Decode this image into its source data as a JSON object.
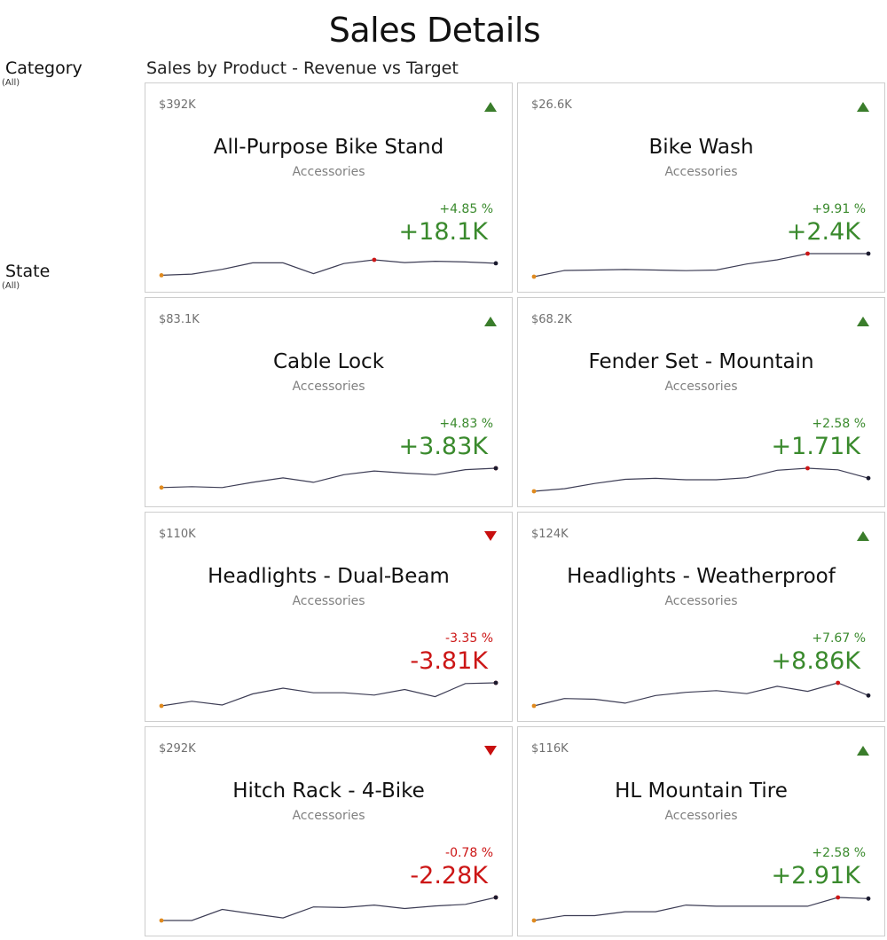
{
  "title": "Sales Details",
  "filters": [
    {
      "label": "Category",
      "value": "(All)"
    },
    {
      "label": "State",
      "value": "(All)"
    }
  ],
  "cards_title": "Sales by Product - Revenue vs Target",
  "colors": {
    "positive": "#3a8a2d",
    "negative": "#cc1616",
    "spark_line": "#3d3d55",
    "spark_start": "#e08a1e",
    "spark_max": "#cc1616",
    "spark_end": "#1a1a2e"
  },
  "cards": [
    {
      "name": "All-Purpose Bike Stand",
      "category": "Accessories",
      "actual": "$392K",
      "percent": "+4.85 %",
      "delta": "+18.1K",
      "trend": "up",
      "sparkline": [
        0.06,
        0.11,
        0.32,
        0.6,
        0.6,
        0.13,
        0.57,
        0.73,
        0.61,
        0.67,
        0.64,
        0.58
      ]
    },
    {
      "name": "Bike Wash",
      "category": "Accessories",
      "actual": "$26.6K",
      "percent": "+9.91 %",
      "delta": "+2.4K",
      "trend": "up",
      "sparkline": [
        0.0,
        0.27,
        0.29,
        0.31,
        0.29,
        0.26,
        0.29,
        0.55,
        0.73,
        1.0,
        1.0,
        1.0
      ]
    },
    {
      "name": "Cable Lock",
      "category": "Accessories",
      "actual": "$83.1K",
      "percent": "+4.83 %",
      "delta": "+3.83K",
      "trend": "up",
      "sparkline": [
        0.16,
        0.2,
        0.16,
        0.39,
        0.58,
        0.39,
        0.72,
        0.88,
        0.79,
        0.72,
        0.94,
        1.0
      ]
    },
    {
      "name": "Fender Set - Mountain",
      "category": "Accessories",
      "actual": "$68.2K",
      "percent": "+2.58 %",
      "delta": "+1.71K",
      "trend": "up",
      "sparkline": [
        0.0,
        0.11,
        0.34,
        0.52,
        0.56,
        0.5,
        0.5,
        0.59,
        0.91,
        1.0,
        0.93,
        0.57
      ]
    },
    {
      "name": "Headlights - Dual-Beam",
      "category": "Accessories",
      "actual": "$110K",
      "percent": "-3.35 %",
      "delta": "-3.81K",
      "trend": "down",
      "sparkline": [
        0.0,
        0.2,
        0.04,
        0.52,
        0.77,
        0.57,
        0.57,
        0.47,
        0.71,
        0.4,
        0.97,
        1.0
      ]
    },
    {
      "name": "Headlights - Weatherproof",
      "category": "Accessories",
      "actual": "$124K",
      "percent": "+7.67 %",
      "delta": "+8.86K",
      "trend": "up",
      "sparkline": [
        0.0,
        0.32,
        0.29,
        0.12,
        0.45,
        0.59,
        0.66,
        0.53,
        0.85,
        0.63,
        1.0,
        0.45
      ]
    },
    {
      "name": "Hitch Rack - 4-Bike",
      "category": "Accessories",
      "actual": "$292K",
      "percent": "-0.78 %",
      "delta": "-2.28K",
      "trend": "down",
      "sparkline": [
        0.0,
        0.0,
        0.48,
        0.29,
        0.11,
        0.59,
        0.56,
        0.67,
        0.52,
        0.63,
        0.7,
        1.0
      ]
    },
    {
      "name": "HL Mountain Tire",
      "category": "Accessories",
      "actual": "$116K",
      "percent": "+2.58 %",
      "delta": "+2.91K",
      "trend": "up",
      "sparkline": [
        0.0,
        0.21,
        0.21,
        0.38,
        0.38,
        0.67,
        0.62,
        0.62,
        0.62,
        0.62,
        1.0,
        0.95
      ]
    }
  ]
}
